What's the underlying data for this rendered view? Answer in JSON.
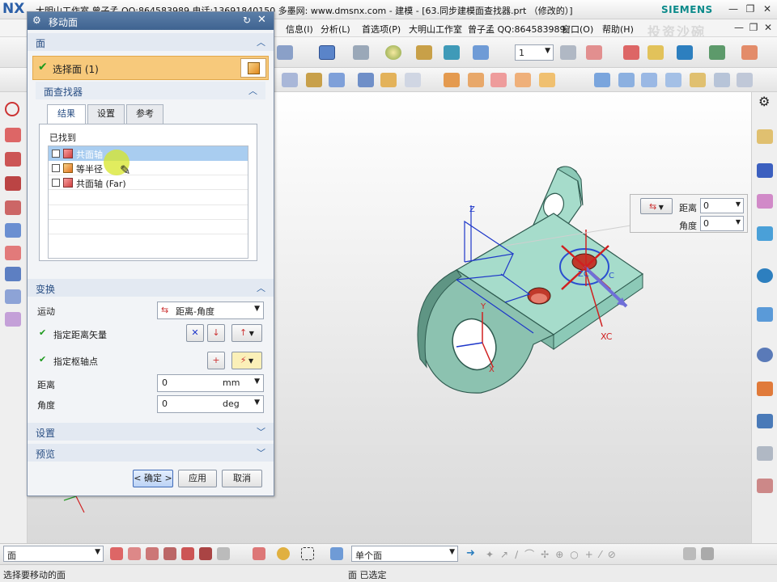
{
  "window": {
    "app_logo": "NX",
    "title": "大明山工作室 曾子孟 QQ:864583989 电话:13691840150 多墨网: www.dmsnx.com - 建模 - [63.同步建模面查找器.prt （修改的）]",
    "brand": "SIEMENS",
    "minimize_icon": "minimize-icon",
    "restore_icon": "restore-icon",
    "close_icon": "close-icon"
  },
  "menubar": {
    "items": [
      "信息(I)",
      "分析(L)",
      "首选项(P)",
      "大明山工作室",
      "曾子孟 QQ:864583989",
      "窗口(O)",
      "帮助(H)"
    ],
    "watermark": "投资沙碗"
  },
  "toolbar": {
    "layer_value": "1"
  },
  "dialog": {
    "title": "移动面",
    "face_section": "面",
    "select_face_label": "选择面 (1)",
    "face_finder_section": "面查找器",
    "tabs": [
      "结果",
      "设置",
      "参考"
    ],
    "found_label": "已找到",
    "results": [
      {
        "label": "共面轴",
        "selected": true
      },
      {
        "label": "等半径",
        "selected": false
      },
      {
        "label": "共面轴 (Far)",
        "selected": false
      }
    ],
    "transform_section": "变换",
    "motion_label": "运动",
    "motion_value": "距离-角度",
    "distance_vector_label": "指定距离矢量",
    "pivot_label": "指定枢轴点",
    "distance_label": "距离",
    "distance_value": "0",
    "distance_unit": "mm",
    "angle_label": "角度",
    "angle_value": "0",
    "angle_unit": "deg",
    "settings_section": "设置",
    "preview_section": "预览",
    "ok_button": "< 确定 >",
    "apply_button": "应用",
    "cancel_button": "取消"
  },
  "float_panel": {
    "distance_label": "距离",
    "distance_value": "0",
    "angle_label": "角度",
    "angle_value": "0"
  },
  "viewport": {
    "axis_x": "X",
    "axis_y": "Y",
    "axis_z": "Z",
    "axis_xc": "XC",
    "axis_zc": "ZC",
    "axis_c": "C"
  },
  "bottombar": {
    "filter_value": "面",
    "scope_value": "单个面"
  },
  "status": {
    "prompt": "选择要移动的面",
    "selection": "面 已选定"
  },
  "colors": {
    "part_face": "#a6dccb",
    "part_edge": "#2e5a4f",
    "dialog_title": "#3f6390",
    "selected_face": "#f7c97b"
  }
}
